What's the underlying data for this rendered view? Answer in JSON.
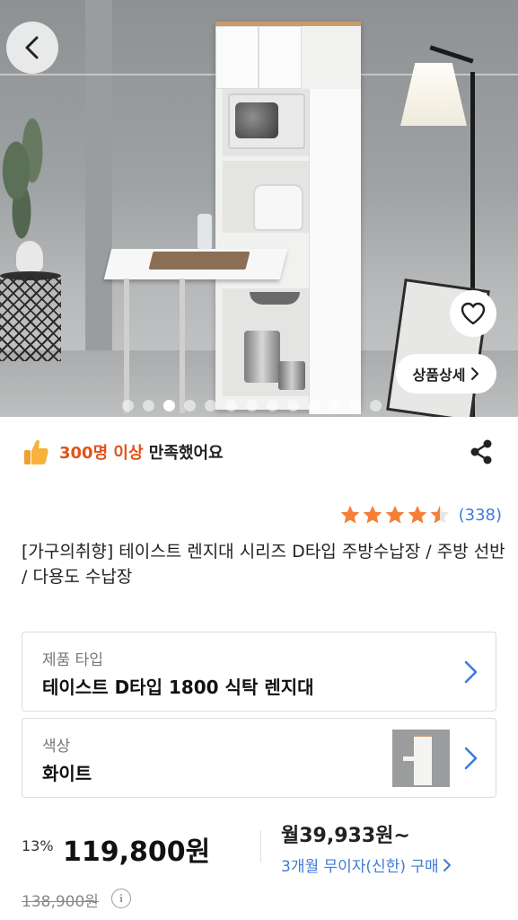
{
  "hero": {
    "dots_count": 13,
    "active_dot": 2,
    "detail_button_label": "상품상세",
    "accent_color": "#ffffff"
  },
  "satisfaction": {
    "highlight": "300명 이상",
    "text": " 만족했어요",
    "highlight_color": "#e0531a"
  },
  "rating": {
    "stars": 4.5,
    "count": "(338)",
    "star_color": "#f57f36"
  },
  "product": {
    "title": "[가구의취향] 테이스트 렌지대 시리즈 D타입 주방수납장 / 주방 선반 / 다용도 수납장"
  },
  "options": [
    {
      "label": "제품 타입",
      "value": "테이스트 D타입 1800 식탁 렌지대"
    },
    {
      "label": "색상",
      "value": "화이트"
    }
  ],
  "price": {
    "discount": "13%",
    "sale_price": "119,800원",
    "monthly": "월39,933원~",
    "installment": "3개월 무이자(신한) 구매",
    "original_price": "138,900원",
    "link_color": "#3d7bd9"
  }
}
